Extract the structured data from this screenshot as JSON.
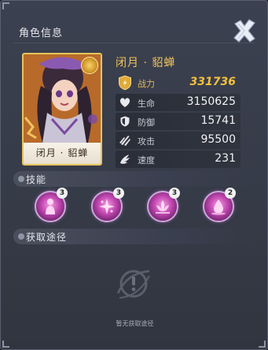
{
  "panel": {
    "title": "角色信息"
  },
  "hero": {
    "name": "闭月 · 貂蝉",
    "card_name": "闭月 · 貂蝉"
  },
  "stats": {
    "power": {
      "label": "战力",
      "value": "331736"
    },
    "hp": {
      "label": "生命",
      "value": "3150625"
    },
    "defense": {
      "label": "防御",
      "value": "15741"
    },
    "attack": {
      "label": "攻击",
      "value": "95500"
    },
    "speed": {
      "label": "速度",
      "value": "231"
    }
  },
  "skills_section": {
    "title": "技能"
  },
  "skills": [
    {
      "level": "3",
      "icon": "figure-skill-icon"
    },
    {
      "level": "3",
      "icon": "petal-burst-skill-icon"
    },
    {
      "level": "3",
      "icon": "lotus-skill-icon"
    },
    {
      "level": "2",
      "icon": "droplet-skill-icon"
    }
  ],
  "source_section": {
    "title": "获取途径",
    "empty_text": "暂无获取途径"
  },
  "colors": {
    "accent_gold": "#f7c13c",
    "name_gold": "#f2c35a",
    "skill_pink": "#c54bb4"
  }
}
